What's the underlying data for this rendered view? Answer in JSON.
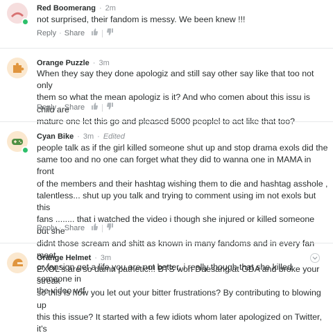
{
  "actions": {
    "reply": "Reply",
    "share": "Share"
  },
  "colors": {
    "online": "#2ec06b",
    "avatar_red": "#d87272",
    "avatar_orange": "#e8a85a",
    "avatar_green": "#4f8f43"
  },
  "comments": [
    {
      "author": "Red Boomerang",
      "time": "2m",
      "edited": "",
      "avatar_icon": "boomerang-icon",
      "text": "not surprised, their fandom is messy. We been knew !!!"
    },
    {
      "author": "Orange Puzzle",
      "time": "3m",
      "edited": "",
      "avatar_icon": "puzzle-icon",
      "text": "When they say they done apologiz and still say other say like that too not only\nthem so what the mean apologiz is it? And who comen about this issu is child are\nmature one let this go and pleased 5000 peoplel to act like that too?"
    },
    {
      "author": "Cyan Bike",
      "time": "3m",
      "edited": "Edited",
      "avatar_icon": "gamepad-icon",
      "text": "people talk as if the girl killed someone shut up and stop drama  exols did the\nsame  too  and no one can forget what they did to wanna one in MAMA in front\nof the members and their hashtag wishing them to die and hashtag asshole ,\ntalentless... shut up you talk and trying to comment using im not exols but this\nfans ........ that i watched the video i though she injured or killed someone but she\ndidnt those scream and shitt as known in many fandoms and in every fan meet\nor fansign get a life you are not better, i really though that she killed someone in\nthe video wtf"
    },
    {
      "author": "Orange Helmet",
      "time": "3m",
      "edited": "",
      "avatar_icon": "helmet-icon",
      "text": "EXOL's are so damn pathetic!!! BTS won Daesang at GDA and broke your streak\nso this is how you let out your bitter frustrations? By contributing to blowing up\nthis this issue? It started with a few idiots whom later apologized on Twitter, it's"
    }
  ]
}
